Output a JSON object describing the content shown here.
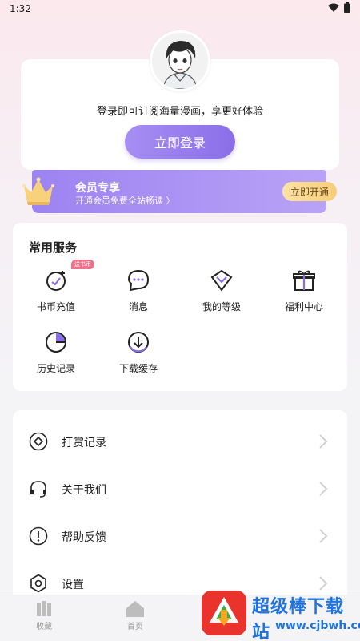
{
  "status_bar": {
    "time": "1:32"
  },
  "login": {
    "tip": "登录即可订阅海量漫画，享更好体验",
    "button_label": "立即登录"
  },
  "vip": {
    "title": "会员专享",
    "subtitle": "开通会员免费全站畅读 〉",
    "button_label": "立即开通"
  },
  "services": {
    "title": "常用服务",
    "badge": "送书币",
    "items": [
      {
        "label": "书币充值",
        "icon": "coin-recharge-icon"
      },
      {
        "label": "消息",
        "icon": "message-icon"
      },
      {
        "label": "我的等级",
        "icon": "level-diamond-icon"
      },
      {
        "label": "福利中心",
        "icon": "gift-icon"
      },
      {
        "label": "历史记录",
        "icon": "history-icon"
      },
      {
        "label": "下载缓存",
        "icon": "download-icon"
      }
    ]
  },
  "menu": {
    "items": [
      {
        "label": "打赏记录",
        "icon": "reward-icon"
      },
      {
        "label": "关于我们",
        "icon": "headset-icon"
      },
      {
        "label": "帮助反馈",
        "icon": "help-icon"
      },
      {
        "label": "设置",
        "icon": "settings-icon"
      }
    ]
  },
  "bottom_nav": {
    "items": [
      {
        "label": "收藏",
        "icon": "bookshelf-icon"
      },
      {
        "label": "首页",
        "icon": "home-icon"
      }
    ]
  },
  "watermark": {
    "text": "超级棒下载站",
    "url": "www.cjbwh.com"
  },
  "colors": {
    "accent": "#8a6ee8",
    "vip_gold": "#f6cd79",
    "badge": "#f0708a"
  }
}
